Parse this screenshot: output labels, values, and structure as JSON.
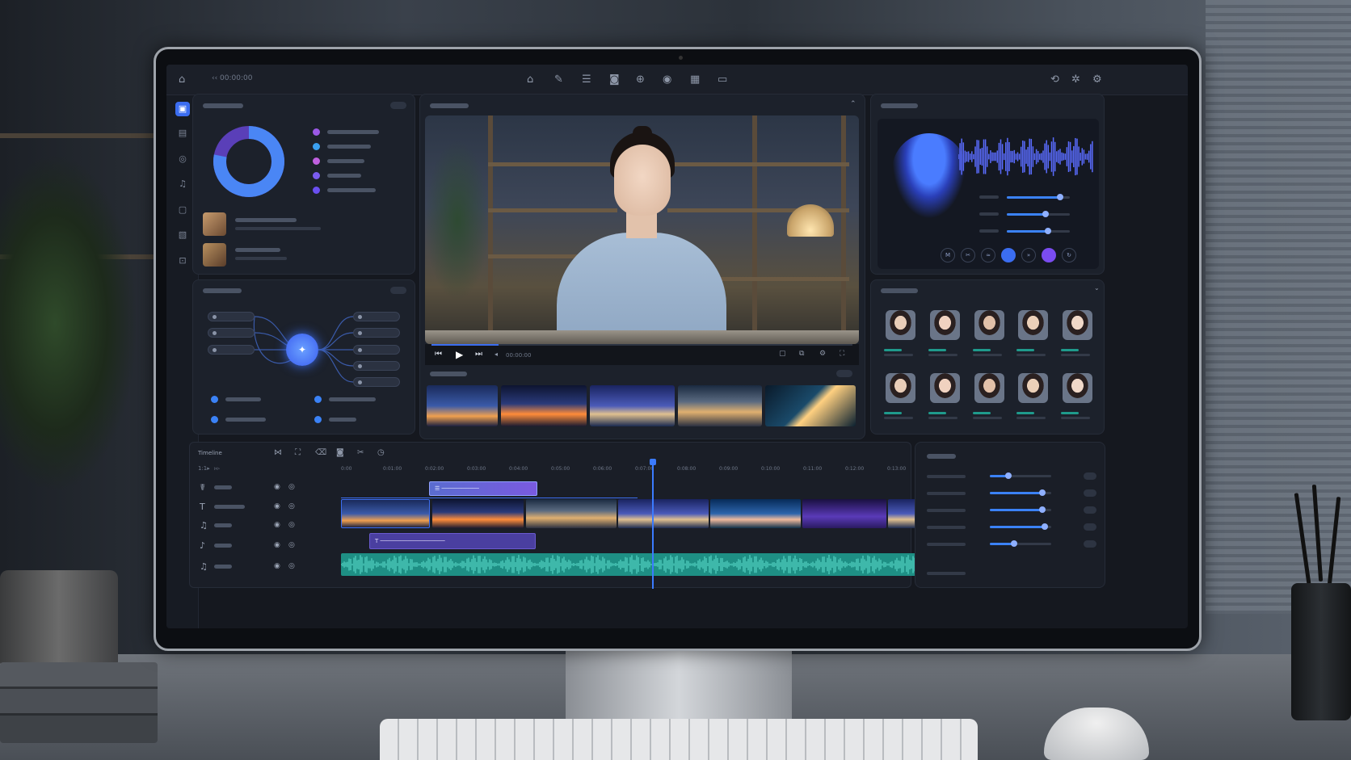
{
  "app": {
    "title": "‹‹ 00:00:00",
    "timecode": "00:00:00"
  },
  "topbar": {
    "icons": [
      "home-icon",
      "edit-icon",
      "menu-icon",
      "camera-icon",
      "ai-icon",
      "eye-icon",
      "grid-icon",
      "export-icon"
    ],
    "right_icons": [
      "sync-icon",
      "magic-icon",
      "settings-icon"
    ]
  },
  "sidebar": {
    "items": [
      "media",
      "layouts",
      "avatars",
      "voices",
      "text",
      "templates",
      "export"
    ]
  },
  "timeline": {
    "label": "Timeline",
    "ticks": [
      "0:00",
      "0:01:00",
      "0:02:00",
      "0:03:00",
      "0:04:00",
      "0:05:00",
      "0:06:00",
      "0:07:00",
      "0:08:00",
      "0:09:00",
      "0:10:00",
      "0:11:00",
      "0:12:00",
      "0:13:00"
    ],
    "tracks": [
      {
        "icon": "avatar-track-icon",
        "glyph": "☤"
      },
      {
        "icon": "text-track-icon",
        "glyph": "T"
      },
      {
        "icon": "music-track-icon",
        "glyph": "♫"
      },
      {
        "icon": "voice-track-icon",
        "glyph": "♪"
      },
      {
        "icon": "audio-track-icon",
        "glyph": "♫"
      }
    ]
  },
  "colors": {
    "accent": "#3b6df0",
    "donut_primary": "#4a86f5",
    "donut_secondary": "#5a3fb8",
    "audio_track": "#1e8f84",
    "text_clip": "#4a3fa0"
  },
  "stats": {
    "donut_share_primary": 0.78,
    "legend_colors": [
      "#9b59e6",
      "#3aa0f0",
      "#c060e0",
      "#7a5cf0",
      "#6a4ff0"
    ]
  },
  "voice": {
    "slider_levels": [
      0.85,
      0.62,
      0.65
    ]
  },
  "properties": {
    "slider_levels": [
      0.3,
      0.85,
      0.85,
      0.9,
      0.4
    ]
  }
}
